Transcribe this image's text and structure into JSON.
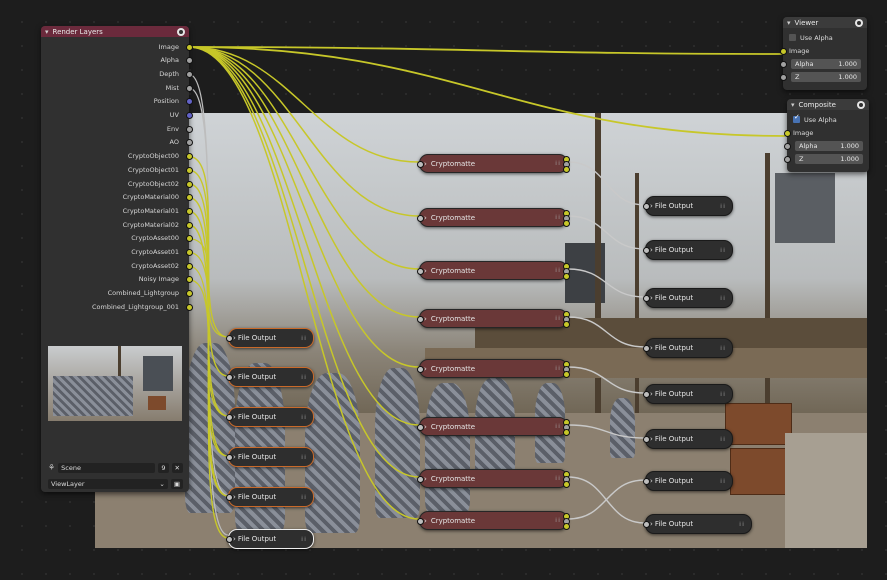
{
  "render_layers": {
    "title": "Render Layers",
    "outputs": [
      "Image",
      "Alpha",
      "Depth",
      "Mist",
      "Position",
      "UV",
      "Env",
      "AO",
      "CryptoObject00",
      "CryptoObject01",
      "CryptoObject02",
      "CryptoMaterial00",
      "CryptoMaterial01",
      "CryptoMaterial02",
      "CryptoAsset00",
      "CryptoAsset01",
      "CryptoAsset02",
      "Noisy Image",
      "Combined_Lightgroup",
      "Combined_Lightgroup_001"
    ],
    "scene": "Scene",
    "scene_users": "9",
    "view_layer": "ViewLayer"
  },
  "viewer": {
    "title": "Viewer",
    "use_alpha_label": "Use Alpha",
    "use_alpha": false,
    "image_label": "Image",
    "alpha_label": "Alpha",
    "alpha_value": "1.000",
    "z_label": "Z",
    "z_value": "1.000"
  },
  "composite": {
    "title": "Composite",
    "use_alpha_label": "Use Alpha",
    "use_alpha": true,
    "image_label": "Image",
    "alpha_label": "Alpha",
    "alpha_value": "1.000",
    "z_label": "Z",
    "z_value": "1.000"
  },
  "cryptomatte_nodes": [
    "Cryptomatte",
    "Cryptomatte",
    "Cryptomatte",
    "Cryptomatte",
    "Cryptomatte",
    "Cryptomatte",
    "Cryptomatte",
    "Cryptomatte"
  ],
  "file_output_right": [
    "File Output",
    "File Output",
    "File Output",
    "File Output",
    "File Output",
    "File Output",
    "File Output",
    "File Output"
  ],
  "file_output_left": [
    "File Output",
    "File Output",
    "File Output",
    "File Output",
    "File Output",
    "File Output"
  ],
  "colors": {
    "image_socket": "#c7c729",
    "value_socket": "#a1a1a1",
    "vector_socket": "#6363c7",
    "header_render_layers": "#6b2a3c",
    "cryptomatte_body": "#6a3838",
    "selected_outline": "#c96a2a"
  }
}
